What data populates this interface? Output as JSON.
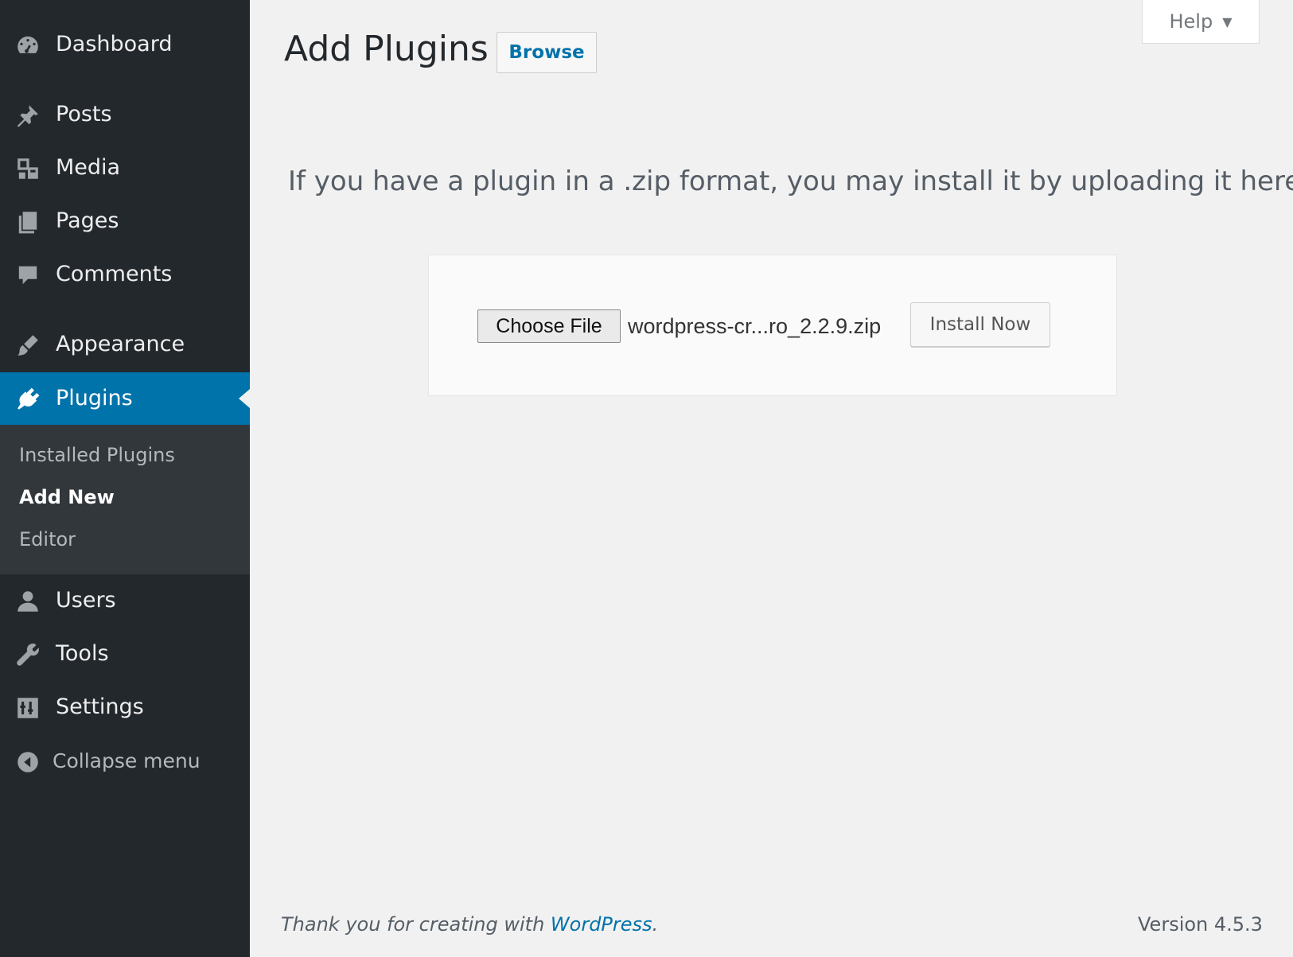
{
  "sidebar": {
    "items": [
      {
        "label": "Dashboard",
        "icon": "dashboard-icon"
      },
      {
        "label": "Posts",
        "icon": "pushpin-icon"
      },
      {
        "label": "Media",
        "icon": "media-icon"
      },
      {
        "label": "Pages",
        "icon": "pages-icon"
      },
      {
        "label": "Comments",
        "icon": "comment-bubble-icon"
      },
      {
        "label": "Appearance",
        "icon": "paintbrush-icon"
      },
      {
        "label": "Plugins",
        "icon": "plug-icon",
        "current": true
      },
      {
        "label": "Users",
        "icon": "user-icon"
      },
      {
        "label": "Tools",
        "icon": "wrench-icon"
      },
      {
        "label": "Settings",
        "icon": "sliders-icon"
      }
    ],
    "submenu": [
      {
        "label": "Installed Plugins"
      },
      {
        "label": "Add New",
        "current": true
      },
      {
        "label": "Editor"
      }
    ],
    "collapse_label": "Collapse menu"
  },
  "header": {
    "help_label": "Help",
    "title": "Add Plugins",
    "browse_label": "Browse"
  },
  "upload": {
    "message": "If you have a plugin in a .zip format, you may install it by uploading it here.",
    "choose_file_label": "Choose File",
    "file_name": "wordpress-cr...ro_2.2.9.zip",
    "install_label": "Install Now"
  },
  "footer": {
    "thanks_prefix": "Thank you for creating with ",
    "thanks_link": "WordPress",
    "thanks_suffix": ".",
    "version": "Version 4.5.3"
  },
  "colors": {
    "sidebar_bg": "#23282d",
    "submenu_bg": "#32373c",
    "accent": "#0073aa",
    "page_bg": "#f1f1f1"
  }
}
